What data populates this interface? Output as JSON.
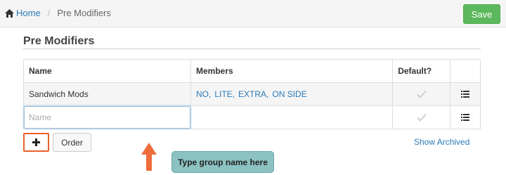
{
  "breadcrumb": {
    "home_label": "Home",
    "current_label": "Pre Modifiers"
  },
  "toolbar": {
    "save_label": "Save"
  },
  "section": {
    "title": "Pre Modifiers"
  },
  "table": {
    "headers": {
      "name": "Name",
      "members": "Members",
      "default": "Default?"
    },
    "rows": [
      {
        "name": "Sandwich Mods",
        "members": [
          "NO,",
          "LITE,",
          "EXTRA,",
          "ON SIDE"
        ],
        "default": false
      }
    ],
    "new_row": {
      "name_placeholder": "Name",
      "name_value": ""
    }
  },
  "buttons": {
    "add_label": "+",
    "order_label": "Order",
    "show_archived_label": "Show Archived"
  },
  "annotation": {
    "tooltip_text": "Type group name here"
  },
  "colors": {
    "accent": "#2a7ab8",
    "save": "#5cb85c",
    "highlight": "#e8612c",
    "tooltip_bg": "#8cc2c2"
  },
  "icons": {
    "home": "home-icon",
    "check": "check-icon",
    "list": "list-icon",
    "plus": "plus-icon",
    "arrow": "up-arrow-icon"
  }
}
